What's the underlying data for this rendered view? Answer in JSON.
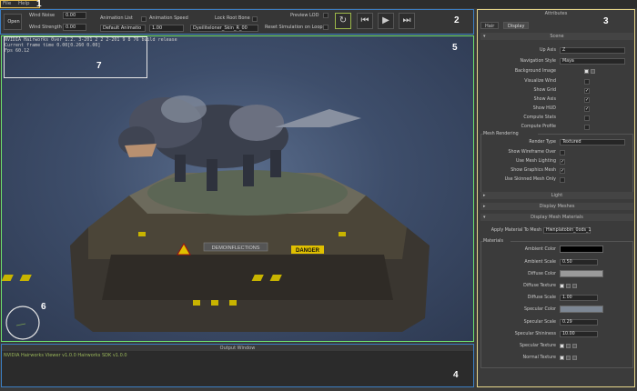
{
  "menu": {
    "file": "File",
    "help": "Help"
  },
  "callouts": [
    "1",
    "2",
    "3",
    "4",
    "5",
    "6",
    "7"
  ],
  "toolbar": {
    "open_label": "Open",
    "wind_noise_label": "Wind Noise",
    "wind_noise_value": "0.00",
    "wind_strength_label": "Wind Strength",
    "wind_strength_value": "0.00",
    "animation_list_label": "Animation List",
    "animation_list_value": "Default Animatio",
    "animation_speed_label": "Animation Speed",
    "animation_speed_value": "1.00",
    "lock_root_bone_label": "Lock Root Bone",
    "root_bone_value": "Dyeiliteloner_Skin_R_00",
    "preview_lod_label": "Preview LOD",
    "reset_sim_label": "Reset Simulation on Loop",
    "icons": [
      "refresh-icon",
      "skip-back-icon",
      "play-icon",
      "skip-forward-icon"
    ]
  },
  "hud": {
    "line1": "NVIDIA Hairworks 0ver 1.2. 3-201 2 2 2-201 9 8 76 build release",
    "line2": "Current frame time 0.00[0.260 0.00]",
    "line3": "Fps 60.12"
  },
  "output": {
    "title": "Output Window",
    "log": "NVIDIA Hairworks Viewer v1.0.0  Hairworks SDK v1.0.0"
  },
  "attributes": {
    "title": "Attributes",
    "tabs": [
      "Hair",
      "Display"
    ],
    "scene_title": "Scene",
    "up_axis_label": "Up Axis",
    "up_axis_value": "Z",
    "nav_style_label": "Navigation Style",
    "nav_style_value": "Maya",
    "bg_image_label": "Background Image",
    "visualize_wind_label": "Visualize Wind",
    "show_grid_label": "Show Grid",
    "show_axis_label": "Show Axis",
    "show_hud_label": "Show HUD",
    "compute_stats_label": "Compute Stats",
    "compute_profile_label": "Compute Profile",
    "mesh_rendering_title": "Mesh Rendering",
    "render_type_label": "Render Type",
    "render_type_value": "Textured",
    "show_wireframe_label": "Show Wireframe Over",
    "use_mesh_lighting_label": "Use Mesh Lighting",
    "show_graphics_mesh_label": "Show Graphics Mesh",
    "use_skinned_mesh_label": "Use Skinned Mesh Only",
    "light_title": "Light",
    "display_meshes_title": "Display Meshes",
    "display_mesh_materials_title": "Display Mesh Materials",
    "apply_material_label": "Apply Material To Mesh",
    "apply_material_value": "Hwnplatobin_0ods_1",
    "materials_title": "Materials",
    "ambient_color_label": "Ambient Color",
    "ambient_scale_label": "Ambient Scale",
    "ambient_scale_value": "0.50",
    "diffuse_color_label": "Diffuse Color",
    "diffuse_texture_label": "Diffuse Texture",
    "diffuse_scale_label": "Diffuse Scale",
    "diffuse_scale_value": "1.00",
    "specular_color_label": "Specular Color",
    "specular_scale_label": "Specular Scale",
    "specular_scale_value": "0.29",
    "specular_shininess_label": "Specular Shininess",
    "specular_shininess_value": "10.00",
    "specular_texture_label": "Specular Texture",
    "normal_texture_label": "Normal Texture",
    "colors": {
      "ambient": "#000000",
      "diffuse": "#9a9a9a",
      "specular": "#7d8794"
    }
  },
  "viewport": {
    "danger_sign": "DANGER",
    "platform_text": "DEMOINFLECTIONS"
  }
}
